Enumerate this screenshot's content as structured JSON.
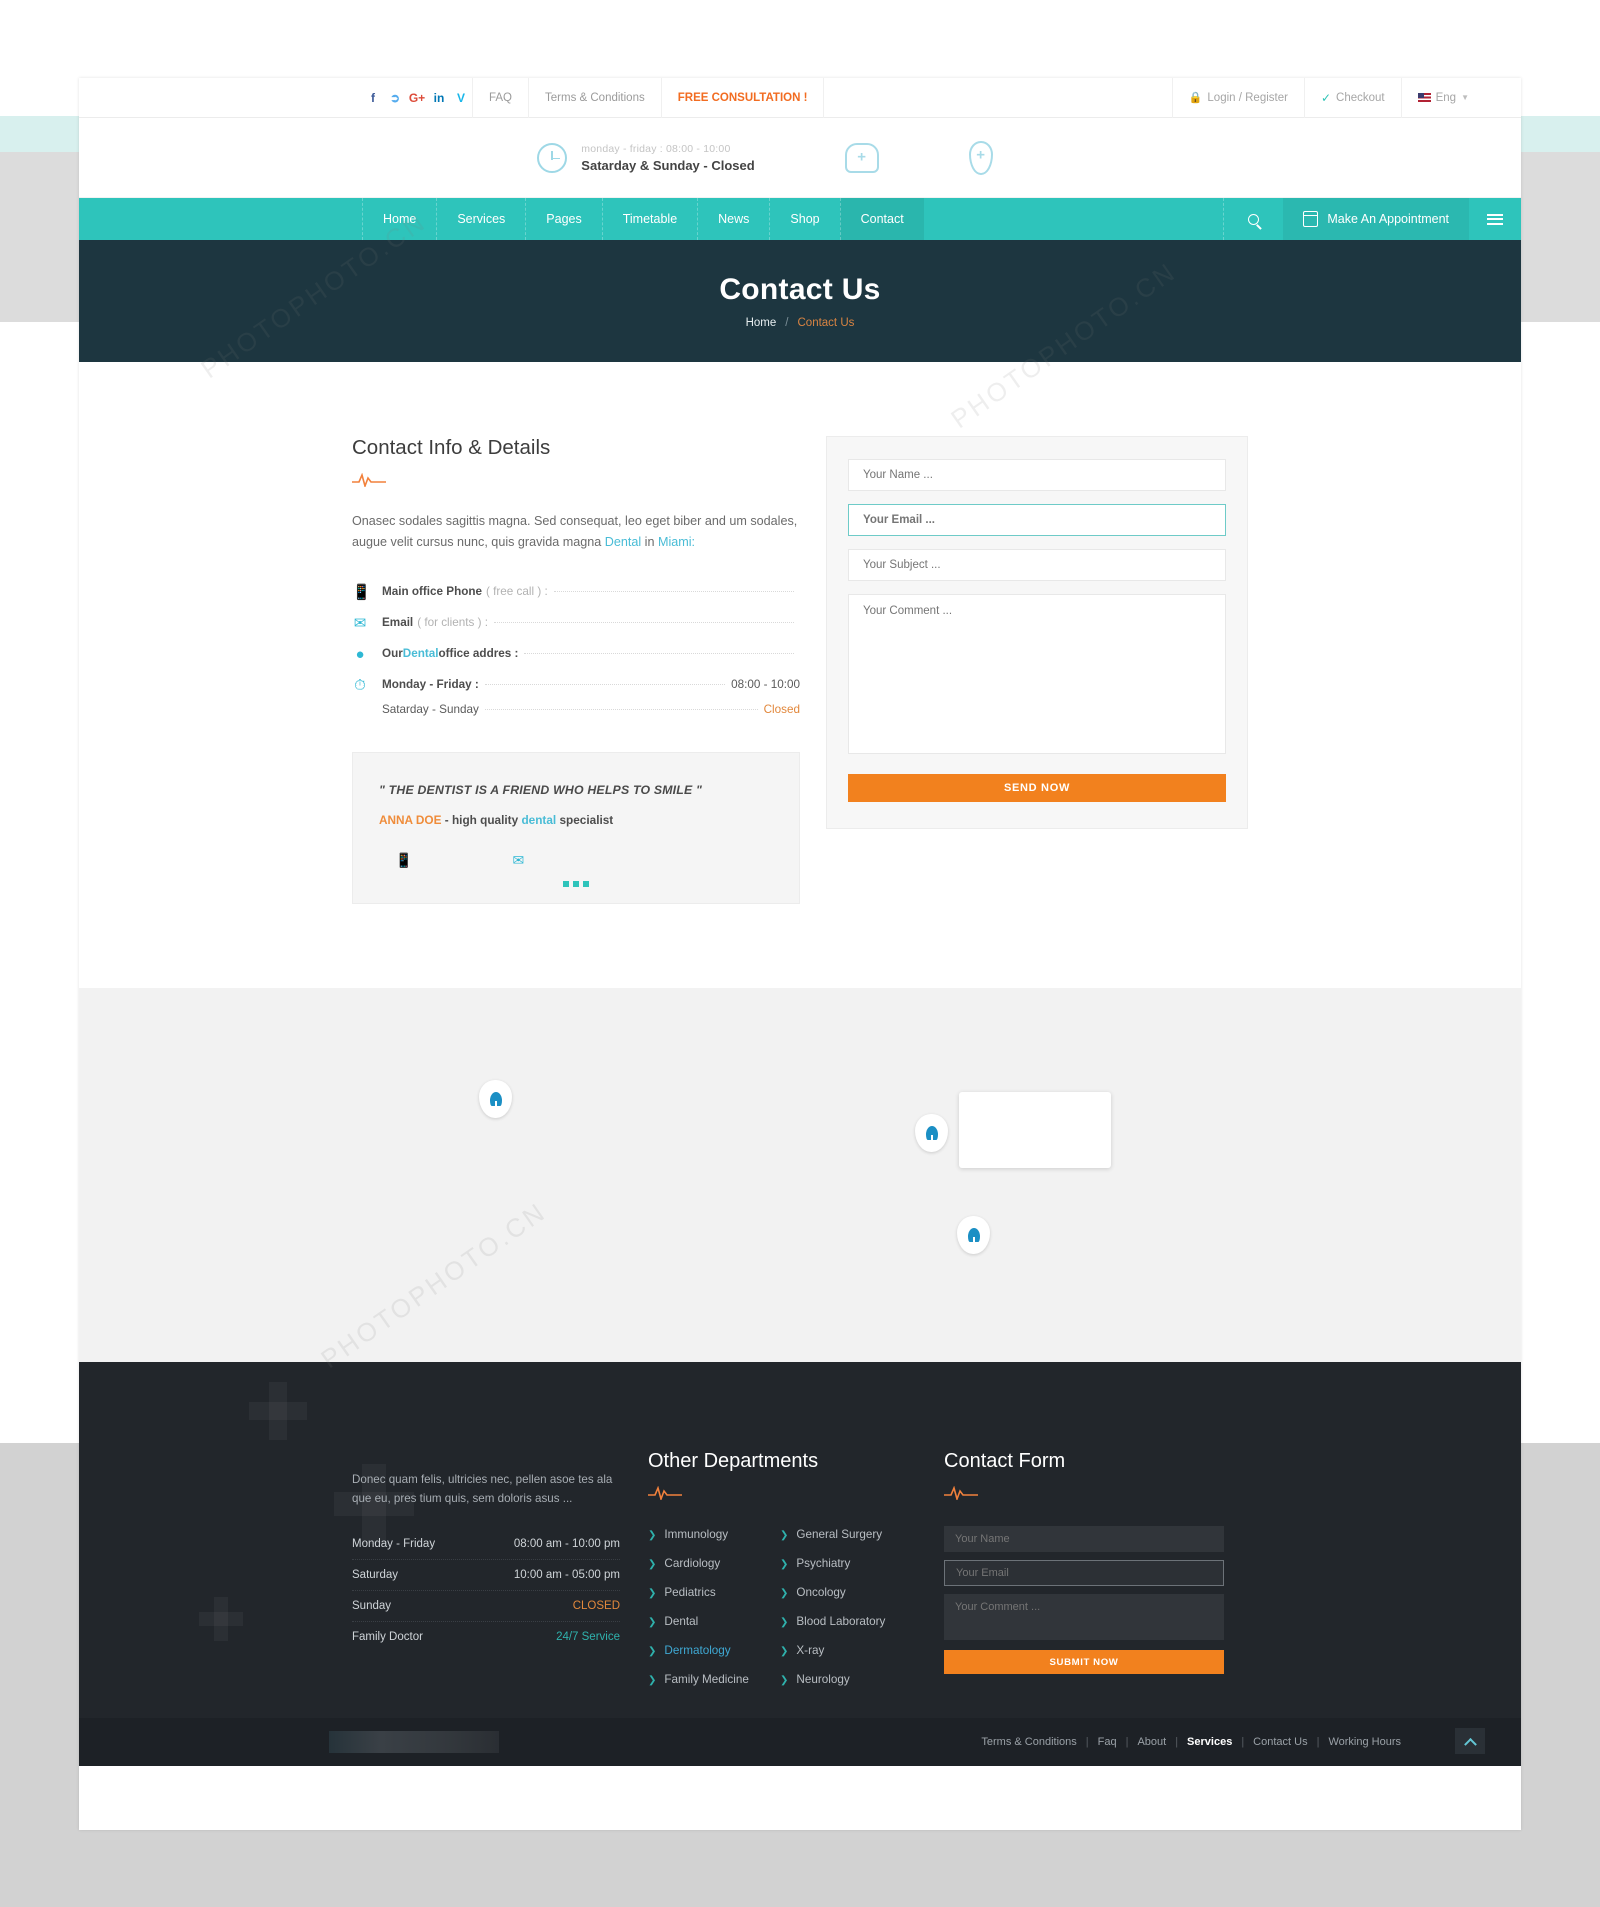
{
  "topbar": {
    "social": [
      {
        "name": "facebook-icon",
        "glyph": "f"
      },
      {
        "name": "twitter-icon",
        "glyph": "ᴠ"
      },
      {
        "name": "google-plus-icon",
        "glyph": "G+"
      },
      {
        "name": "linkedin-icon",
        "glyph": "in"
      },
      {
        "name": "vimeo-icon",
        "glyph": "V"
      }
    ],
    "links": [
      {
        "label": "FAQ",
        "highlight": false
      },
      {
        "label": "Terms & Conditions",
        "highlight": false
      },
      {
        "label": "FREE CONSULTATION !",
        "highlight": true
      }
    ],
    "login": "Login / Register",
    "checkout": "Checkout",
    "language": "Eng",
    "accent_orange": "#f26c21"
  },
  "header": {
    "hours_line1": "monday - friday : 08:00 - 10:00",
    "hours_line2": "Satarday & Sunday - Closed"
  },
  "nav": {
    "items": [
      {
        "label": "Home",
        "active": false
      },
      {
        "label": "Services",
        "active": false
      },
      {
        "label": "Pages",
        "active": false
      },
      {
        "label": "Timetable",
        "active": false
      },
      {
        "label": "News",
        "active": false
      },
      {
        "label": "Shop",
        "active": false
      },
      {
        "label": "Contact",
        "active": true
      }
    ],
    "appointment": "Make An Appointment",
    "accent_teal": "#2ec4bb"
  },
  "hero": {
    "title": "Contact Us",
    "breadcrumb_home": "Home",
    "breadcrumb_sep": "/",
    "breadcrumb_current": "Contact Us",
    "bg": "#1d3640"
  },
  "contact_info": {
    "title": "Contact Info & Details",
    "paragraph_1": "Onasec sodales sagittis magna. Sed consequat, leo eget biber and um sodales,",
    "paragraph_2a": "augue velit cursus nunc, quis gravida magna ",
    "paragraph_link1": "Dental",
    "paragraph_2b": " in ",
    "paragraph_link2": "Miami:",
    "rows": [
      {
        "icon": "mobile-phone-icon",
        "label": "Main office Phone",
        "soft": "( free call ) :",
        "value": ""
      },
      {
        "icon": "envelope-icon",
        "label": "Email",
        "soft": "( for clients ) :",
        "value": ""
      },
      {
        "icon": "map-pin-icon",
        "label_pre": "Our ",
        "link": "Dental",
        "label_post": " office addres :",
        "value": ""
      },
      {
        "icon": "clock-icon",
        "label": "Monday - Friday :",
        "soft": "",
        "value": "08:00 - 10:00"
      }
    ],
    "sub_row_label": "Satarday - Sunday",
    "sub_row_value": "Closed"
  },
  "quote": {
    "text": "\" THE DENTIST IS A FRIEND WHO HELPS TO SMILE \"",
    "author": "ANNA DOE",
    "author_rest_a": " - high quality ",
    "author_link": "dental",
    "author_rest_b": " specialist"
  },
  "contact_form": {
    "name_placeholder": "Your Name ...",
    "email_placeholder": "Your Email ...",
    "subject_placeholder": "Your Subject ...",
    "comment_placeholder": "Your Comment ...",
    "submit_label": "SEND NOW",
    "submit_color": "#f2811e"
  },
  "footer": {
    "about_text": "Donec quam felis, ultricies nec, pellen asoe tes ala que eu, pres tium quis, sem doloris asus ...",
    "hours": [
      {
        "day": "Monday - Friday",
        "value": "08:00 am - 10:00 pm",
        "style": "normal"
      },
      {
        "day": "Saturday",
        "value": "10:00 am - 05:00 pm",
        "style": "normal"
      },
      {
        "day": "Sunday",
        "value": "CLOSED",
        "style": "closed"
      },
      {
        "day": "Family Doctor",
        "value": "24/7 Service",
        "style": "service"
      }
    ],
    "departments_title": "Other Departments",
    "departments_col1": [
      {
        "label": "Immunology",
        "highlight": false
      },
      {
        "label": "Cardiology",
        "highlight": false
      },
      {
        "label": "Pediatrics",
        "highlight": false
      },
      {
        "label": "Dental",
        "highlight": false
      },
      {
        "label": "Dermatology",
        "highlight": true
      },
      {
        "label": "Family Medicine",
        "highlight": false
      }
    ],
    "departments_col2": [
      {
        "label": "General Surgery",
        "highlight": false
      },
      {
        "label": "Psychiatry",
        "highlight": false
      },
      {
        "label": "Oncology",
        "highlight": false
      },
      {
        "label": "Blood Laboratory",
        "highlight": false
      },
      {
        "label": "X-ray",
        "highlight": false
      },
      {
        "label": "Neurology",
        "highlight": false
      }
    ],
    "form_title": "Contact Form",
    "form_name": "Your Name",
    "form_email": "Your Email",
    "form_comment": "Your Comment ...",
    "form_submit": "SUBMIT NOW",
    "bottom_links": [
      {
        "label": "Terms & Conditions",
        "current": false
      },
      {
        "label": "Faq",
        "current": false
      },
      {
        "label": "About",
        "current": false
      },
      {
        "label": "Services",
        "current": true
      },
      {
        "label": "Contact Us",
        "current": false
      },
      {
        "label": "Working Hours",
        "current": false
      }
    ]
  },
  "watermarks": {
    "w1": "PHOTOPHOTO.CN",
    "w2": "PHOTOPHOTO.CN",
    "w3": "PHOTOPHOTO.CN"
  }
}
